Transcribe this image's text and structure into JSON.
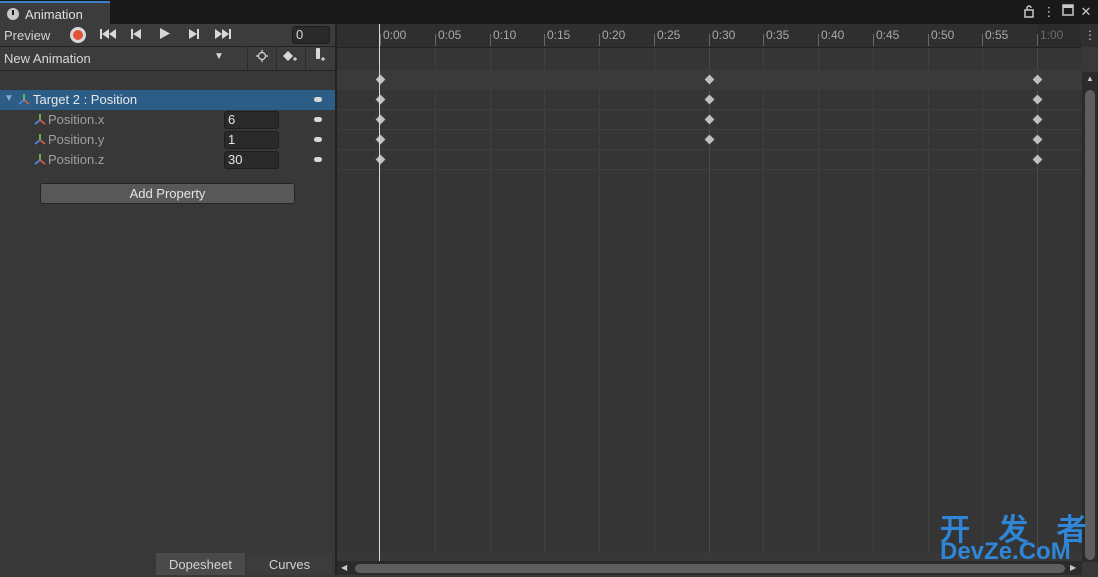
{
  "window": {
    "tab_title": "Animation",
    "lock_icon": "lock-icon",
    "menu_icon": "kebab-menu-icon",
    "maximize_icon": "maximize-icon",
    "close_icon": "close-icon"
  },
  "toolbar": {
    "preview_label": "Preview",
    "buttons": [
      "record",
      "first-key",
      "prev-key",
      "play",
      "next-key",
      "last-key"
    ],
    "current_frame": "0"
  },
  "clip": {
    "name": "New Animation",
    "buttons": [
      "filter-by-selection",
      "add-keyframe",
      "add-event"
    ]
  },
  "properties": {
    "group": {
      "label": "Target 2 : Position",
      "expanded": true
    },
    "rows": [
      {
        "label": "Position.x",
        "value": "6"
      },
      {
        "label": "Position.y",
        "value": "1"
      },
      {
        "label": "Position.z",
        "value": "30"
      }
    ],
    "add_property_label": "Add Property"
  },
  "bottom_tabs": {
    "dopesheet": "Dopesheet",
    "curves": "Curves",
    "active": "Dopesheet"
  },
  "timeline": {
    "tick_labels": [
      "0:00",
      "0:05",
      "0:10",
      "0:15",
      "0:20",
      "0:25",
      "0:30",
      "0:35",
      "0:40",
      "0:45",
      "0:50",
      "0:55",
      "1:00"
    ],
    "playhead_time": "0:00",
    "keyframes": {
      "summary": [
        "0:00",
        "0:30",
        "1:00"
      ],
      "group": [
        "0:00",
        "0:30",
        "1:00"
      ],
      "position_x": [
        "0:00",
        "0:30",
        "1:00"
      ],
      "position_y": [
        "0:00",
        "0:30",
        "1:00"
      ],
      "position_z": [
        "0:00",
        "1:00"
      ]
    }
  },
  "watermark": {
    "top": "开 发 者",
    "bottom": "DevZe.CoM"
  },
  "colors": {
    "accent": "#2c5d87",
    "record": "#e3513a",
    "watermark": "#2f86d6"
  }
}
